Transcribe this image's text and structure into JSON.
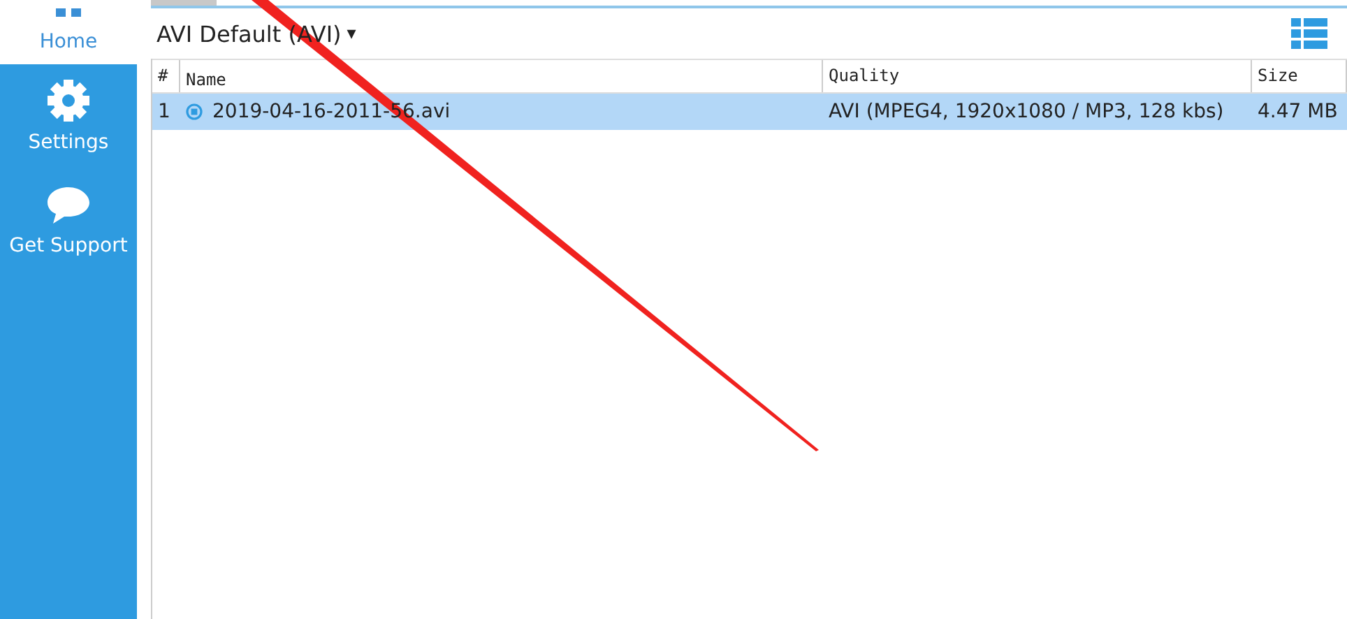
{
  "sidebar": {
    "items": [
      {
        "label": "Home",
        "kind": "home",
        "selected": true
      },
      {
        "label": "Settings",
        "kind": "gear",
        "selected": false
      },
      {
        "label": "Get Support",
        "kind": "chat",
        "selected": false
      }
    ]
  },
  "profile": {
    "label": "AVI Default (AVI)",
    "caret": "▾"
  },
  "table": {
    "columns": [
      "#",
      "Name",
      "Quality",
      "Size"
    ],
    "rows": [
      {
        "index": "1",
        "name": "2019-04-16-2011-56.avi",
        "quality": "AVI (MPEG4, 1920x1080 / MP3, 128 kbs)",
        "size": "4.47 MB",
        "selected": true
      }
    ]
  }
}
